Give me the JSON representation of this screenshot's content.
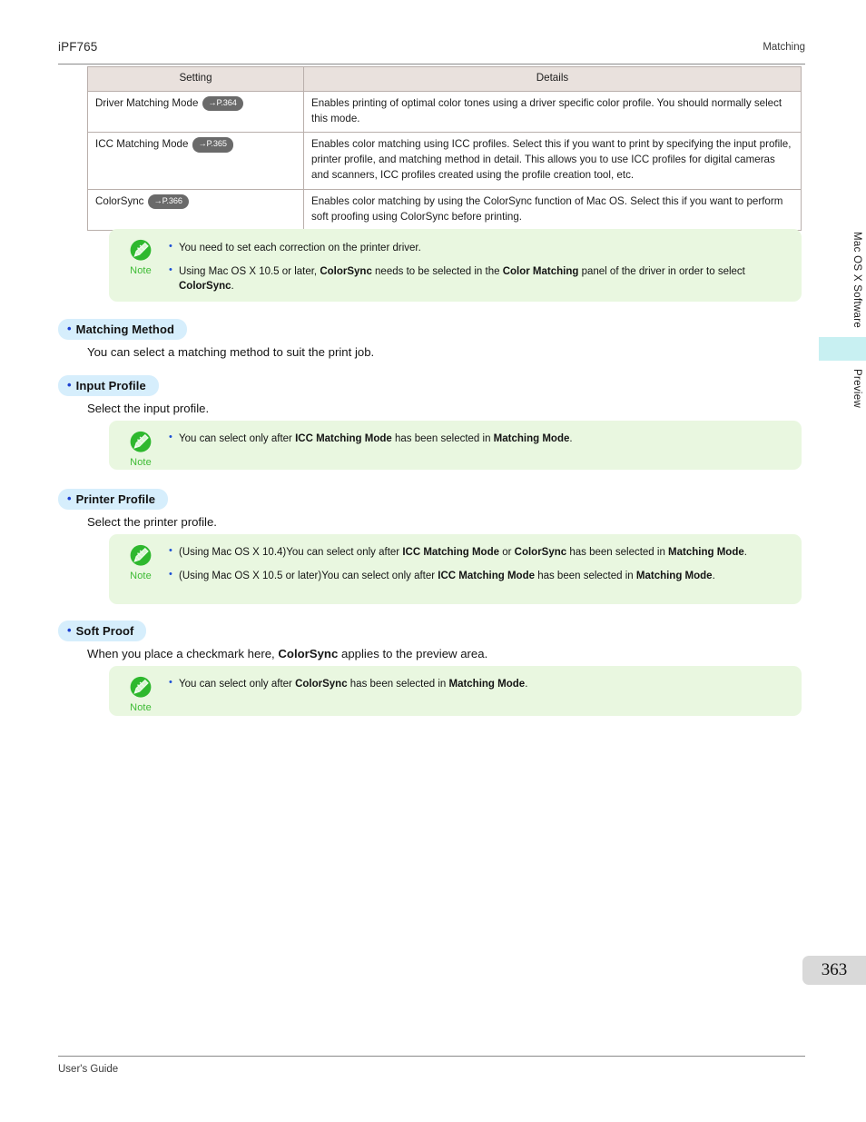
{
  "header": {
    "model": "iPF765",
    "section": "Matching"
  },
  "table": {
    "columns": [
      "Setting",
      "Details"
    ],
    "rows": [
      {
        "setting": "Driver Matching Mode",
        "page_ref": "→P.364",
        "details": "Enables printing of optimal color tones using a driver specific color profile. You should normally select this mode."
      },
      {
        "setting": "ICC Matching Mode",
        "page_ref": "→P.365",
        "details": "Enables color matching using ICC profiles. Select this if you want to print by specifying the input profile, printer profile, and matching method in detail. This allows you to use ICC profiles for digital cameras and scanners, ICC profiles created using the profile creation tool, etc."
      },
      {
        "setting": "ColorSync",
        "page_ref": "→P.366",
        "details": "Enables color matching by using the ColorSync function of Mac OS. Select this if you want to perform soft proofing using ColorSync before printing."
      }
    ]
  },
  "note_label": "Note",
  "note1": {
    "item1": "You need to set each correction on the printer driver.",
    "item2_a": "Using Mac OS X 10.5 or later, ",
    "item2_b1": "ColorSync",
    "item2_c": " needs to be selected in the ",
    "item2_b2": "Color Matching",
    "item2_d": " panel of the driver in order to select ",
    "item2_b3": "ColorSync",
    "item2_e": "."
  },
  "sections": {
    "matching_method": {
      "title": "Matching Method",
      "body": "You can select a matching method to suit the print job."
    },
    "input_profile": {
      "title": "Input Profile",
      "body": "Select the input profile."
    },
    "printer_profile": {
      "title": "Printer Profile",
      "body": "Select the printer profile."
    },
    "soft_proof": {
      "title": "Soft Proof",
      "body_a": "When you place a checkmark here, ",
      "body_b": "ColorSync",
      "body_c": " applies to the preview area."
    }
  },
  "note2": {
    "a": "You can select only after ",
    "b1": "ICC Matching Mode",
    "c": " has been selected in ",
    "b2": "Matching Mode",
    "d": "."
  },
  "note3": {
    "item1_a": "(Using Mac OS X 10.4)You can select only after ",
    "item1_b1": "ICC Matching Mode",
    "item1_c": " or ",
    "item1_b2": "ColorSync",
    "item1_d": " has been selected in ",
    "item1_b3": "Matching Mode",
    "item1_e": ".",
    "item2_a": "(Using Mac OS X 10.5 or later)You can select only after ",
    "item2_b1": "ICC Matching Mode",
    "item2_c": " has been selected in ",
    "item2_b2": "Matching Mode",
    "item2_d": "."
  },
  "note4": {
    "a": "You can select only after ",
    "b1": "ColorSync",
    "c": " has been selected in ",
    "b2": "Matching Mode",
    "d": "."
  },
  "side_tabs": {
    "chapter": "Mac OS X Software",
    "current": "Preview"
  },
  "page_number": "363",
  "footer": "User's Guide",
  "colors": {
    "note_bg": "#e9f7e0",
    "note_green": "#3dbb34",
    "heading_bg": "#d6eefc",
    "heading_dot": "#1b3fd0",
    "table_header_bg": "#e9e1dd",
    "tab_highlight": "#c8f0f2",
    "page_badge_bg": "#d9d9d9",
    "pref_bg": "#6a6a6a"
  }
}
